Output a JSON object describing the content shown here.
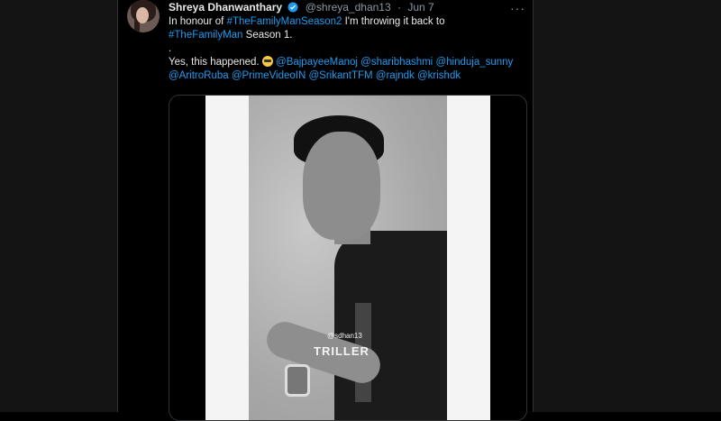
{
  "tweet": {
    "name": "Shreya Dhanwanthary",
    "handle": "@shreya_dhan13",
    "separator": "·",
    "date": "Jun 7",
    "more": "···",
    "line1_prefix": "In honour of ",
    "hashtag1": "#TheFamilyManSeason2",
    "line1_suffix": " I'm throwing it back to",
    "hashtag2": "#TheFamilyMan",
    "line2_suffix": " Season 1.",
    "dot": ".",
    "line4_prefix": "Yes, this happened. ",
    "mentions": [
      "@BajpayeeManoj",
      "@sharibhashmi",
      "@hinduja_sunny",
      "@AritroRuba",
      "@PrimeVideoIN",
      "@SrikantTFM",
      "@rajndk",
      "@krishdk"
    ]
  },
  "video": {
    "watermark_handle": "@sdhan13",
    "watermark_brand": "TRILLER"
  },
  "colors": {
    "link": "#1d9bf0",
    "verified": "#1d9bf0",
    "background": "#000000"
  }
}
